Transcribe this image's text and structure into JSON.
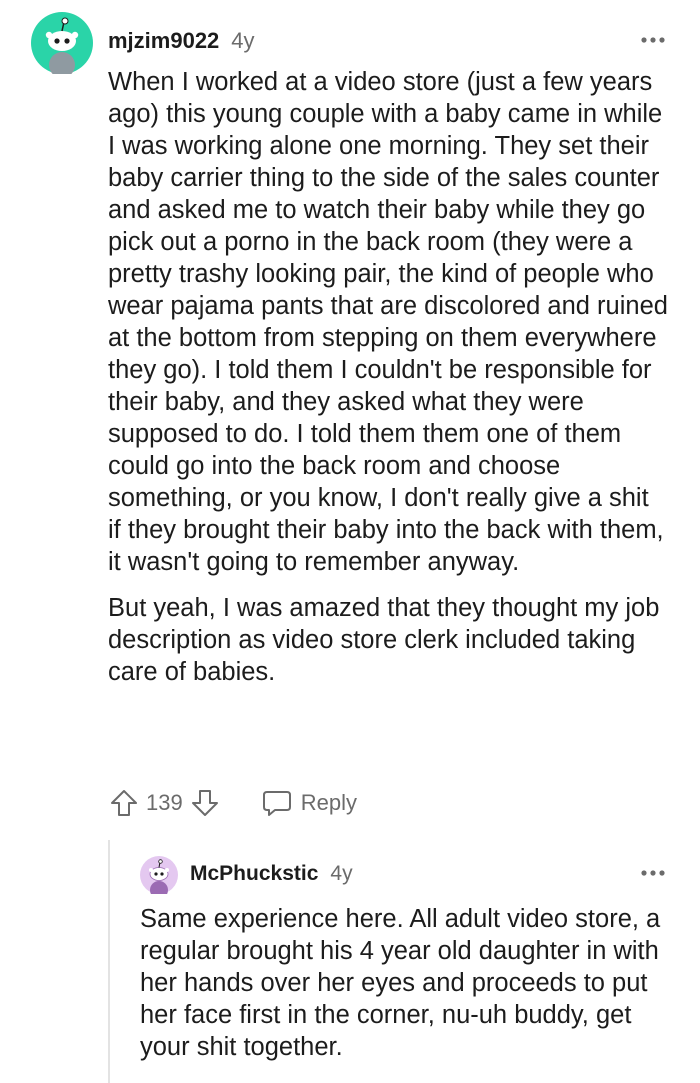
{
  "comment": {
    "username": "mjzim9022",
    "age": "4y",
    "paragraphs": [
      "When I worked at a video store (just a few years ago) this young couple with a baby came in while I was working alone one morning. They set their baby carrier thing to the side of the sales counter and asked me to watch their baby while they go pick out a porno in the back room (they were a pretty trashy looking pair, the kind of people who wear pajama pants that are discolored and ruined at the bottom from stepping on them everywhere they go). I told them I couldn't be responsible for their baby, and they asked what they were supposed to do. I told them them one of them could go into the back room and choose something, or you know, I don't really give a shit if they brought their baby into the back with them, it wasn't going to remember anyway.",
      "But yeah, I was amazed that they thought my job description as video store clerk included taking care of babies."
    ],
    "vote_count": "139",
    "reply_label": "Reply",
    "avatar_color": "#2ad4a8"
  },
  "reply": {
    "username": "McPhuckstic",
    "age": "4y",
    "paragraphs": [
      "Same experience here. All adult video store, a regular brought his 4 year old daughter in with her hands over her eyes and proceeds to put her face first in the corner, nu-uh buddy, get your shit together."
    ],
    "avatar_color": "#e4c8f0"
  },
  "icons": {
    "upvote": "arrow-up-icon",
    "downvote": "arrow-down-icon",
    "reply": "speech-bubble-icon",
    "more": "more-options-icon"
  }
}
